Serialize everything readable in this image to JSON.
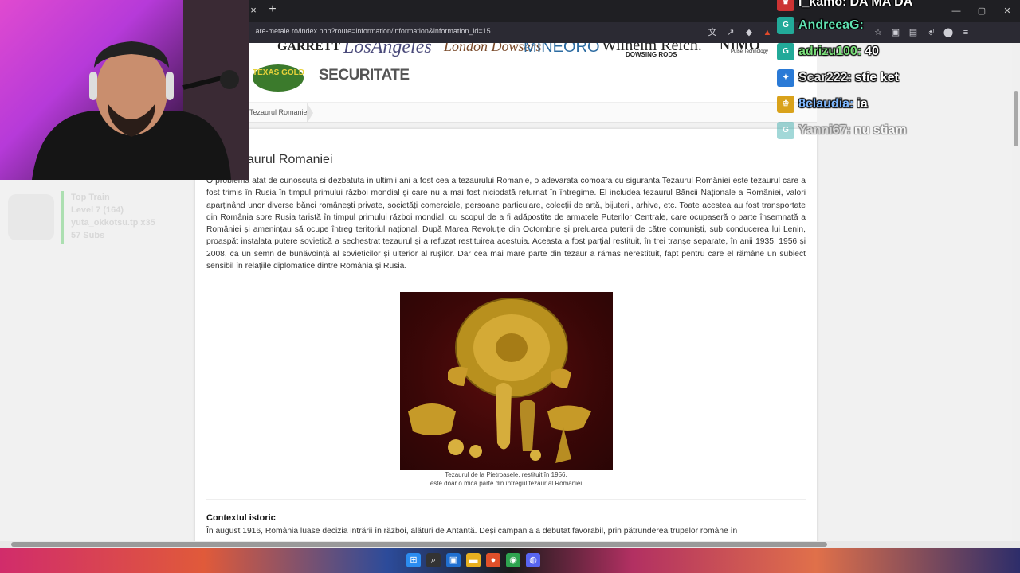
{
  "browser": {
    "tab_close": "×",
    "new_tab": "+",
    "url": "...are-metale.ro/index.php?route=information/information&information_id=15",
    "window_controls": [
      "—",
      "▢",
      "✕"
    ]
  },
  "brands": {
    "garrett": "GARRETT",
    "los_angeles": "LosAngeles",
    "london": "London Dowsers",
    "mineoro": "MINEORO",
    "wilhelm": "Wilhelm Reich.",
    "dowsing_rods": "DOWSING RODS",
    "nimo": "NIMO",
    "pulse": "Pulse Technology",
    "texas": "TEXAS GOLD",
    "securitate": "SECURITATE"
  },
  "breadcrumb": "Tezaurul Romaniei",
  "page": {
    "title": "Tezaurul Romaniei",
    "intro": "O problema atat de cunoscuta si dezbatuta in ultimii ani a fost cea a tezaurului Romanie, o adevarata comoara cu siguranta.Tezaurul României este tezaurul care a fost trimis în Rusia în timpul primului război mondial și care nu a mai fost niciodată returnat în întregime. El includea tezaurul Băncii Naționale a României, valori aparținând unor diverse bănci românești private, societăți comerciale, persoane particulare, colecții de artă, bijuterii, arhive, etc. Toate acestea au fost transportate din România spre Rusia țaristă în timpul primului război mondial, cu scopul de a fi adăpostite de armatele Puterilor Centrale, care ocupaseră o parte însemnată a României și amenințau să ocupe întreg teritoriul național. După Marea Revoluție din Octombrie și preluarea puterii de către comuniști, sub conducerea lui Lenin, proaspăt instalata putere sovietică a sechestrat tezaurul și a refuzat restituirea acestuia. Aceasta a fost parțial restituit, în trei tranșe separate, în anii 1935, 1956 și 2008, ca un semn de bunăvoință al sovieticilor și ulterior al rușilor. Dar cea mai mare parte din tezaur a rămas nerestituit, fapt pentru care el rămâne un subiect sensibil în relațiile diplomatice dintre România și Rusia.",
    "caption_line1": "Tezaurul de la Pietroasele, restituit în 1956,",
    "caption_line2": "este doar o mică parte din întregul tezaur al României",
    "section_title": "Contextul istoric",
    "section_text": "În august 1916, România luase decizia intrării în război, alături de Antantă. Deși campania a debutat favorabil, prin pătrunderea trupelor române în"
  },
  "train": {
    "title": "Top Train",
    "level": "Level 7  (164)",
    "user": "yuta_okkotsu.tp x35",
    "subs": "57 Subs"
  },
  "chat": [
    {
      "name": "i_kamo:",
      "message": "DA MA DA",
      "name_color": "#ffffff",
      "badge_color": "#c33"
    },
    {
      "name": "AndreeaG:",
      "message": "",
      "name_color": "#5fe0b0",
      "badge_color": "#2a9"
    },
    {
      "name": "adrizu100:",
      "message": "40",
      "name_color": "#7be07b",
      "badge_color": "#2a9"
    },
    {
      "name": "Scar222:",
      "message": "stie ket",
      "name_color": "#e8e8e8",
      "badge_color": "#2a7ad6"
    },
    {
      "name": "8claudia:",
      "message": "ia",
      "name_color": "#7fb8ff",
      "badge_color": "#d9a21b"
    },
    {
      "name": "Yanni67:",
      "message": "nu stiam",
      "name_color": "#bbbbbb",
      "badge_color": "#3aa"
    }
  ],
  "colors": {
    "accent": "#2fbf3b",
    "chrome_dark": "#1f1f23"
  }
}
